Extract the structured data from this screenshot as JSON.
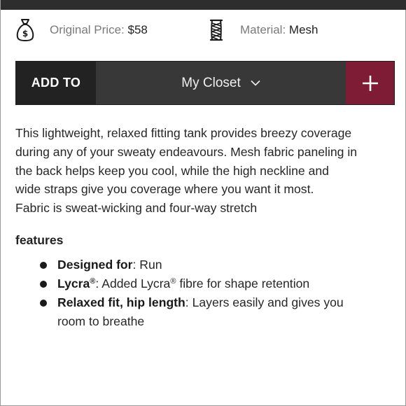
{
  "meta": {
    "price_label": "Original Price:",
    "price_value": "$58",
    "price_icon": "money-bag-icon",
    "material_label": "Material:",
    "material_value": "Mesh",
    "material_icon": "fabric-spool-icon"
  },
  "add_bar": {
    "add_to_label": "ADD TO",
    "closet_value": "My Closet",
    "plus_label": "+",
    "accent_color": "#7e1c35"
  },
  "description": {
    "line1": "This lightweight, relaxed fitting tank provides breezy coverage",
    "line2": "during any of your sweaty endeavours. Mesh fabric paneling in",
    "line3": "the back helps keep you cool, while the high neckline and",
    "line4": "wide straps give you coverage where you want it most.",
    "line5": "Fabric is sweat-wicking and four-way stretch"
  },
  "features": {
    "heading": "features",
    "items": [
      {
        "title": "Designed for",
        "text": ": Run"
      },
      {
        "title": "Lycra",
        "title_mark": "®",
        "text": ": Added Lycra",
        "text_mark": "®",
        "text_after": " fibre for shape retention"
      },
      {
        "title": "Relaxed fit, hip length",
        "text": ": Layers easily and gives you",
        "text_line2": "room to breathe"
      }
    ]
  }
}
